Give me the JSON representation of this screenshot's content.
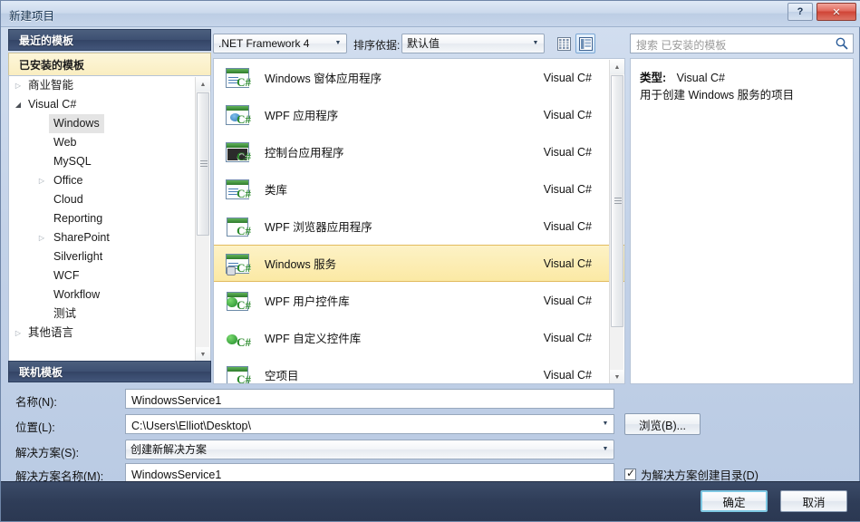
{
  "window": {
    "title": "新建项目",
    "help_button": "?",
    "close_button": "✕"
  },
  "left_panel": {
    "recent_header": "最近的模板",
    "installed_header": "已安装的模板",
    "online_header": "联机模板",
    "tree": [
      {
        "label": "商业智能",
        "depth": 0,
        "arrow": "collapsed",
        "selected": false
      },
      {
        "label": "Visual C#",
        "depth": 0,
        "arrow": "expanded",
        "selected": false
      },
      {
        "label": "Windows",
        "depth": 1,
        "arrow": "none",
        "selected": true
      },
      {
        "label": "Web",
        "depth": 1,
        "arrow": "none",
        "selected": false
      },
      {
        "label": "MySQL",
        "depth": 1,
        "arrow": "none",
        "selected": false
      },
      {
        "label": "Office",
        "depth": 1,
        "arrow": "collapsed",
        "selected": false
      },
      {
        "label": "Cloud",
        "depth": 1,
        "arrow": "none",
        "selected": false
      },
      {
        "label": "Reporting",
        "depth": 1,
        "arrow": "none",
        "selected": false
      },
      {
        "label": "SharePoint",
        "depth": 1,
        "arrow": "collapsed",
        "selected": false
      },
      {
        "label": "Silverlight",
        "depth": 1,
        "arrow": "none",
        "selected": false
      },
      {
        "label": "WCF",
        "depth": 1,
        "arrow": "none",
        "selected": false
      },
      {
        "label": "Workflow",
        "depth": 1,
        "arrow": "none",
        "selected": false
      },
      {
        "label": "测试",
        "depth": 1,
        "arrow": "none",
        "selected": false
      },
      {
        "label": "其他语言",
        "depth": 0,
        "arrow": "collapsed",
        "selected": false
      }
    ]
  },
  "toolbar": {
    "framework_value": ".NET Framework 4",
    "sort_label": "排序依据:",
    "sort_value": "默认值",
    "view_small_icon": "small-icons-view-icon",
    "view_large_icon": "large-icons-view-icon",
    "search_placeholder": "搜索 已安装的模板",
    "search_value": "",
    "search_icon": "search-icon"
  },
  "templates": [
    {
      "name": "Windows 窗体应用程序",
      "lang": "Visual C#",
      "icon": "windows-forms-icon",
      "selected": false
    },
    {
      "name": "WPF 应用程序",
      "lang": "Visual C#",
      "icon": "wpf-app-icon",
      "selected": false
    },
    {
      "name": "控制台应用程序",
      "lang": "Visual C#",
      "icon": "console-app-icon",
      "selected": false
    },
    {
      "name": "类库",
      "lang": "Visual C#",
      "icon": "class-library-icon",
      "selected": false
    },
    {
      "name": "WPF 浏览器应用程序",
      "lang": "Visual C#",
      "icon": "wpf-browser-app-icon",
      "selected": false
    },
    {
      "name": "Windows 服务",
      "lang": "Visual C#",
      "icon": "windows-service-icon",
      "selected": true
    },
    {
      "name": "WPF 用户控件库",
      "lang": "Visual C#",
      "icon": "wpf-user-control-library-icon",
      "selected": false
    },
    {
      "name": "WPF 自定义控件库",
      "lang": "Visual C#",
      "icon": "wpf-custom-control-library-icon",
      "selected": false
    },
    {
      "name": "空项目",
      "lang": "Visual C#",
      "icon": "empty-project-icon",
      "selected": false
    }
  ],
  "description": {
    "type_label": "类型:",
    "type_value": "Visual C#",
    "body": "用于创建 Windows 服务的项目"
  },
  "form": {
    "name_label": "名称(N):",
    "name_value": "WindowsService1",
    "location_label": "位置(L):",
    "location_value": "C:\\Users\\Elliot\\Desktop\\",
    "solution_label": "解决方案(S):",
    "solution_value": "创建新解决方案",
    "solution_name_label": "解决方案名称(M):",
    "solution_name_value": "WindowsService1",
    "browse_button": "浏览(B)...",
    "create_dir_label": "为解决方案创建目录(D)",
    "create_dir_checked": true
  },
  "footer": {
    "ok_label": "确定",
    "cancel_label": "取消"
  },
  "colors": {
    "dialog_bg": "#c3d2e8",
    "header_navy": "#3d5072",
    "selection_yellow": "#fbe9a4",
    "footer_navy": "#2f3d58",
    "accent_blue": "#7ec8e3",
    "close_red": "#cf4436"
  }
}
